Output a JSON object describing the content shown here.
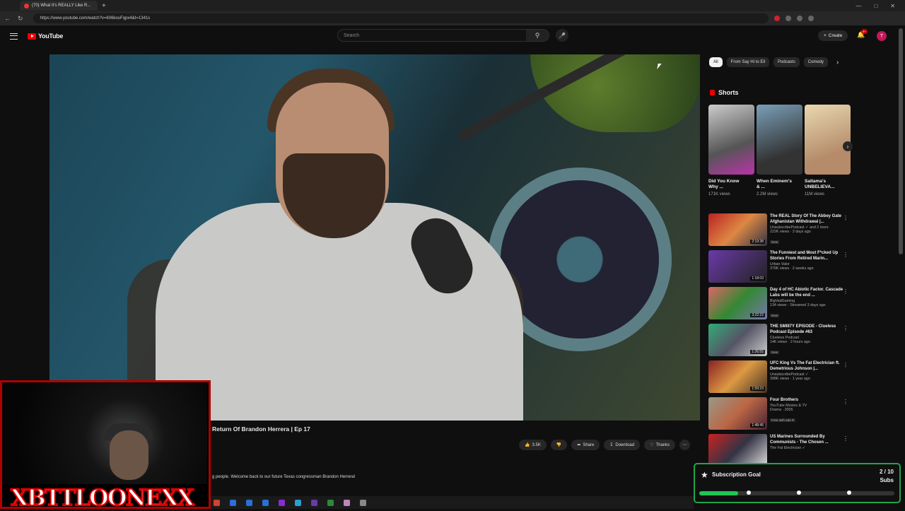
{
  "browser": {
    "tab_title": "(70) What It's REALLY Like R...",
    "url": "https://www.youtube.com/watch?v=606kouFqpx4&t=1341s"
  },
  "masthead": {
    "logo": "YouTube",
    "search_placeholder": "Search",
    "create_label": "Create",
    "notif_badge": "9+",
    "avatar_initial": "T"
  },
  "video": {
    "title": "Return Of Brandon Herrera | Ep 17",
    "likes": "3.5K",
    "share": "Share",
    "download": "Download",
    "thanks": "Thanks",
    "description": "g people. Welcome back to our future Texas congressman Brandon Herrera!"
  },
  "chips": [
    "All",
    "From Say Hi to Ell",
    "Podcasts",
    "Comedy"
  ],
  "shorts": {
    "heading": "Shorts",
    "items": [
      {
        "title": "Did You Know Why ...",
        "views": "171K views"
      },
      {
        "title": "When Eminem's & ...",
        "views": "2.2M views"
      },
      {
        "title": "Saitama's UNBELIEVA...",
        "views": "11M views"
      }
    ]
  },
  "recommendations": [
    {
      "title": "The REAL Story Of The Abbey Gate Afghanistan Withdrawal |...",
      "channel": "UnsubscribePodcast ✓ and 2 more",
      "meta": "222K views · 3 days ago",
      "badge": "New",
      "duration": "2:19:38"
    },
    {
      "title": "The Funniest and Most F*cked Up Stories From Retired Marin...",
      "channel": "Urban Valor",
      "meta": "379K views · 2 weeks ago",
      "badge": "",
      "duration": "1:18:03"
    },
    {
      "title": "Day 4 of HC Abiotic Factor. Cascade Labs will be the end ...",
      "channel": "BigVadGaming",
      "meta": "134 views · Streamed 3 days ago",
      "badge": "New",
      "duration": "3:22:22"
    },
    {
      "title": "THE SMIII7Y EPISODE - Clueless Podcast Episode #63",
      "channel": "Clueless Podcast",
      "meta": "14K views · 2 hours ago",
      "badge": "New",
      "duration": "1:26:55"
    },
    {
      "title": "UFC King Vs The Fat Electrician ft. Demetrious Johnson |...",
      "channel": "UnsubscribePodcast ✓",
      "meta": "398K views · 1 year ago",
      "badge": "",
      "duration": "1:59:23"
    },
    {
      "title": "Four Brothers",
      "channel": "YouTube Movies & TV",
      "meta": "Drama · 2005",
      "badge": "Free with ads  R",
      "duration": "1:48:45"
    },
    {
      "title": "US Marines Surrounded By Communists - The Chosen ...",
      "channel": "The Fat Electrician ✓",
      "meta": "",
      "badge": "",
      "duration": ""
    }
  ],
  "overlay": {
    "webcam_tag": "XBTTLOONEXX",
    "goal_title": "Subscription Goal",
    "goal_count": "2 / 10",
    "goal_unit": "Subs",
    "goal_progress": 0.2
  }
}
